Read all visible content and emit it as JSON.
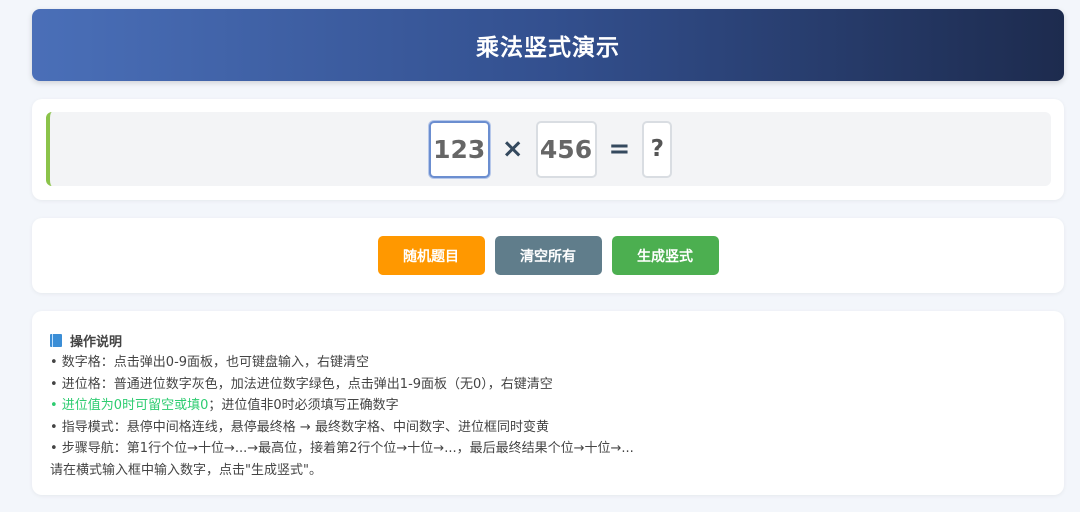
{
  "header": {
    "title": "乘法竖式演示"
  },
  "equation": {
    "multiplicand": "123",
    "times_sign": "×",
    "multiplier": "456",
    "equals_sign": "=",
    "result": "?"
  },
  "buttons": {
    "random": "随机题目",
    "clear": "清空所有",
    "generate": "生成竖式"
  },
  "help": {
    "title": "操作说明",
    "line1": "• 数字格：点击弹出0-9面板，也可键盘输入，右键清空",
    "line2": "• 进位格：普通进位数字灰色，加法进位数字绿色，点击弹出1-9面板（无0），右键清空",
    "line3_highlight": "• 进位值为0时可留空或填0",
    "line3_rest": "；进位值非0时必须填写正确数字",
    "line4": "• 指导模式：悬停中间格连线，悬停最终格 → 最终数字格、中间数字、进位框同时变黄",
    "line5": "• 步骤导航：第1行个位→十位→...→最高位，接着第2行个位→十位→...，最后最终结果个位→十位→...",
    "status": "请在横式输入框中输入数字，点击\"生成竖式\"。"
  },
  "colors": {
    "accent_green": "#8bc34a",
    "random_button": "#ff9800",
    "clear_button": "#607d8b",
    "generate_button": "#4caf50",
    "highlight_text": "#2ecc71"
  }
}
